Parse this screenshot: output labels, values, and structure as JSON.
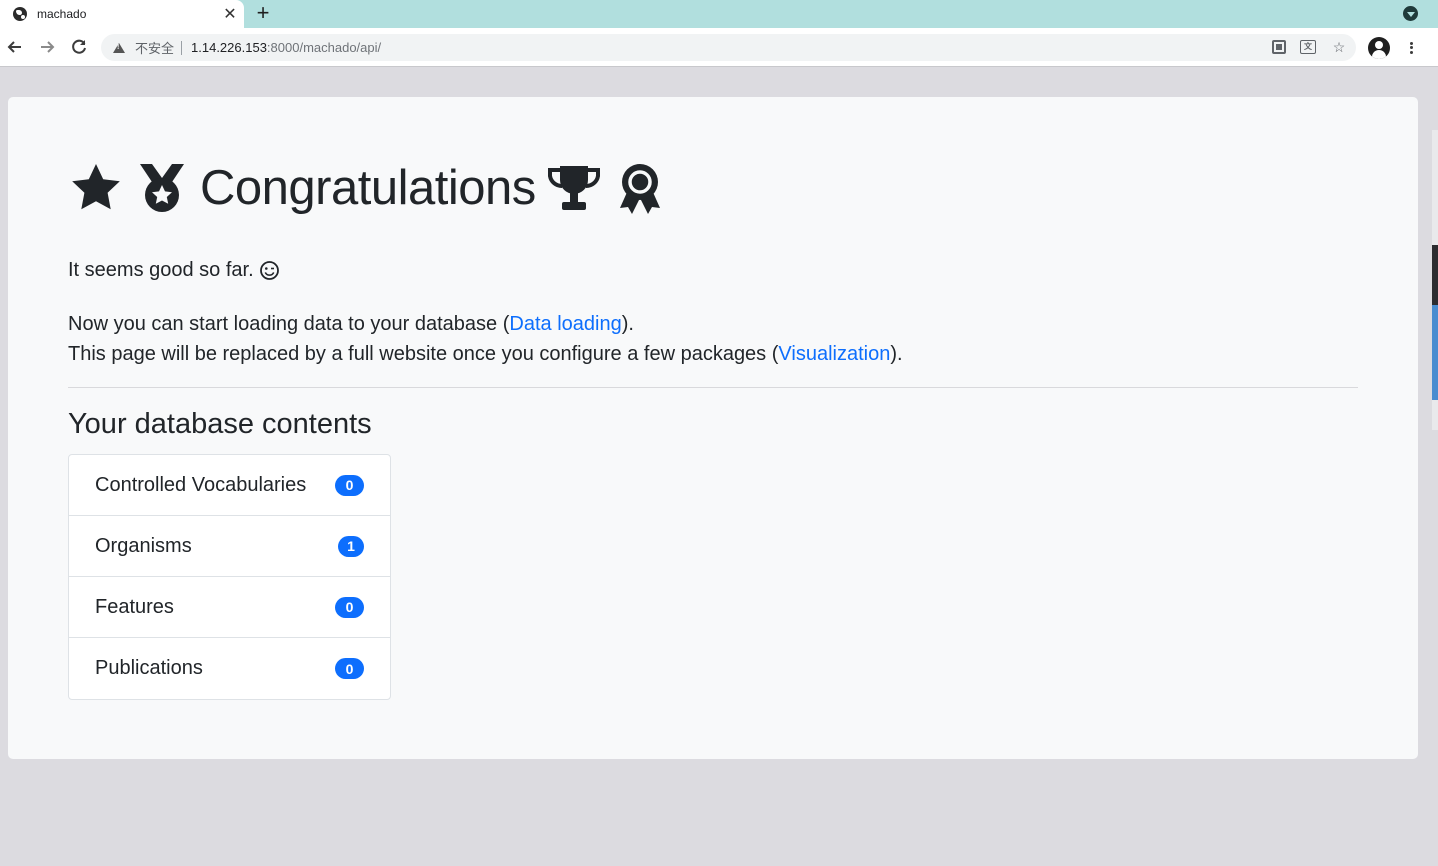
{
  "browser": {
    "tab_title": "machado",
    "tab_close": "✕",
    "new_tab": "+",
    "security_label": "不安全",
    "url_host": "1.14.226.153",
    "url_path": ":8000/machado/api/"
  },
  "icons": {
    "heading": [
      "star-icon",
      "medal-icon",
      "trophy-icon",
      "award-ribbon-icon"
    ],
    "lead": "smile-wink-icon",
    "accent": "#0d6efd"
  },
  "page": {
    "title": "Congratulations",
    "lead_text": "It seems good so far.",
    "para_line1_before": "Now you can start loading data to your database (",
    "link_data_loading": "Data loading",
    "para_line1_after": ").",
    "para_line2_before": "This page will be replaced by a full website once you configure a few packages (",
    "link_visualization": "Visualization",
    "para_line2_after": ").",
    "section_title": "Your database contents",
    "items": [
      {
        "label": "Controlled Vocabularies",
        "count": "0"
      },
      {
        "label": "Organisms",
        "count": "1"
      },
      {
        "label": "Features",
        "count": "0"
      },
      {
        "label": "Publications",
        "count": "0"
      }
    ]
  }
}
